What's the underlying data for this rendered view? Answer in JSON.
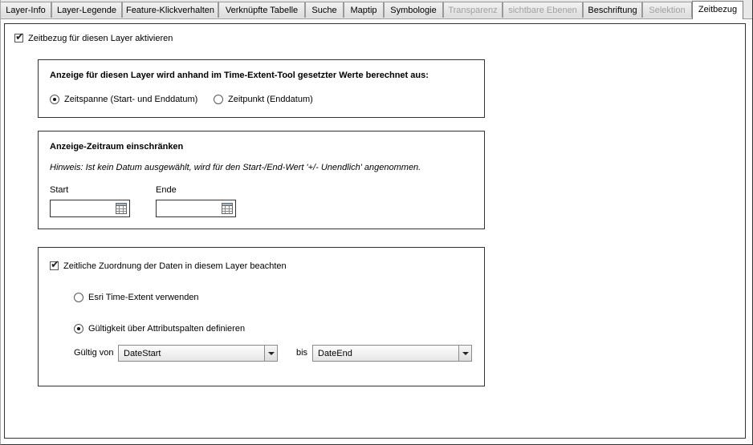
{
  "tabs": [
    {
      "label": "Layer-Info",
      "state": "normal"
    },
    {
      "label": "Layer-Legende",
      "state": "normal"
    },
    {
      "label": "Feature-Klickverhalten",
      "state": "normal"
    },
    {
      "label": "Verknüpfte Tabelle",
      "state": "normal"
    },
    {
      "label": "Suche",
      "state": "normal"
    },
    {
      "label": "Maptip",
      "state": "normal"
    },
    {
      "label": "Symbologie",
      "state": "normal"
    },
    {
      "label": "Transparenz",
      "state": "disabled"
    },
    {
      "label": "sichtbare Ebenen",
      "state": "disabled"
    },
    {
      "label": "Beschriftung",
      "state": "normal"
    },
    {
      "label": "Selektion",
      "state": "disabled"
    },
    {
      "label": "Zeitbezug",
      "state": "active"
    }
  ],
  "enable_time": {
    "label": "Zeitbezug für diesen Layer aktivieren",
    "checked": true
  },
  "calc_group": {
    "title": "Anzeige für diesen Layer wird anhand im Time-Extent-Tool gesetzter Werte berechnet aus:",
    "option_span": {
      "label": "Zeitspanne (Start- und Enddatum)",
      "selected": true
    },
    "option_point": {
      "label": "Zeitpunkt (Enddatum)",
      "selected": false
    }
  },
  "range_group": {
    "title": "Anzeige-Zeitraum einschränken",
    "hint": "Hinweis: Ist kein Datum ausgewählt, wird für den Start-/End-Wert '+/- Unendlich' angenommen.",
    "start_label": "Start",
    "start_value": "",
    "end_label": "Ende",
    "end_value": ""
  },
  "mapping_group": {
    "checkbox": {
      "label": "Zeitliche Zuordnung der Daten in diesem Layer beachten",
      "checked": true
    },
    "option_esri": {
      "label": "Esri Time-Extent verwenden",
      "selected": false
    },
    "option_attr": {
      "label": "Gültigkeit über Attributspalten definieren",
      "selected": true
    },
    "valid_from_label": "Gültig von",
    "valid_from_value": "DateStart",
    "to_label": "bis",
    "valid_to_value": "DateEnd"
  }
}
